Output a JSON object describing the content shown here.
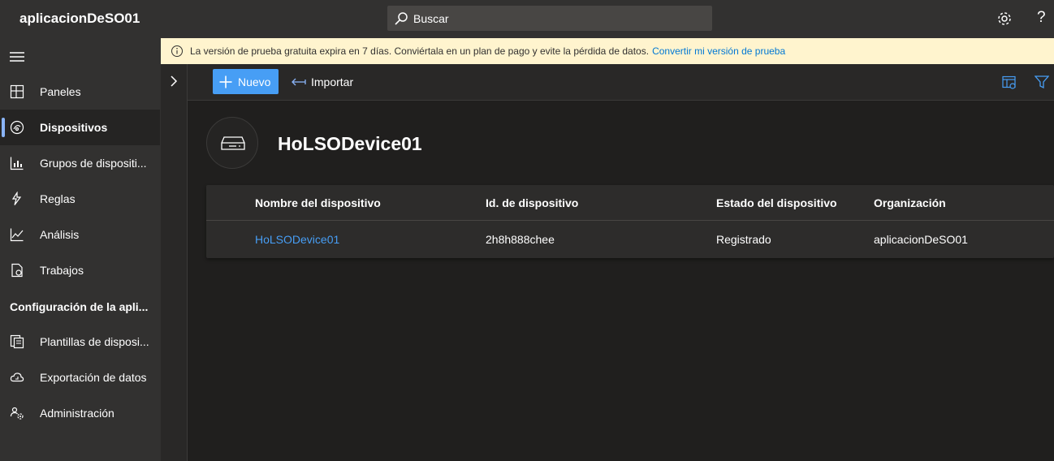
{
  "header": {
    "app_title": "aplicacionDeSO01",
    "search_placeholder": "Buscar",
    "help_label": "?"
  },
  "sidebar": {
    "items": [
      {
        "label": "Paneles",
        "icon": "dashboard-icon"
      },
      {
        "label": "Dispositivos",
        "icon": "devices-icon",
        "active": true
      },
      {
        "label": "Grupos de dispositi...",
        "icon": "device-groups-icon"
      },
      {
        "label": "Reglas",
        "icon": "rules-icon"
      },
      {
        "label": "Análisis",
        "icon": "analytics-icon"
      },
      {
        "label": "Trabajos",
        "icon": "jobs-icon"
      }
    ],
    "section_header": "Configuración de la apli...",
    "config_items": [
      {
        "label": "Plantillas de disposi...",
        "icon": "device-templates-icon"
      },
      {
        "label": "Exportación de datos",
        "icon": "data-export-icon"
      },
      {
        "label": "Administración",
        "icon": "administration-icon"
      }
    ]
  },
  "banner": {
    "text": "La versión de prueba gratuita expira en 7 días. Conviértala en un plan de pago y evite la pérdida de datos.",
    "link": "Convertir mi versión de prueba"
  },
  "toolbar": {
    "new_label": "Nuevo",
    "import_label": "Importar"
  },
  "device": {
    "title": "HoLSODevice01"
  },
  "table": {
    "columns": [
      "Nombre del dispositivo",
      "Id. de dispositivo",
      "Estado del dispositivo",
      "Organización"
    ],
    "rows": [
      {
        "name": "HoLSODevice01",
        "id": "2h8h888chee",
        "status": "Registrado",
        "organization": "aplicacionDeSO01"
      }
    ]
  },
  "colors": {
    "accent": "#479ef5",
    "banner_bg": "#fff4ce",
    "chrome": "#323130",
    "background": "#201f1e"
  }
}
